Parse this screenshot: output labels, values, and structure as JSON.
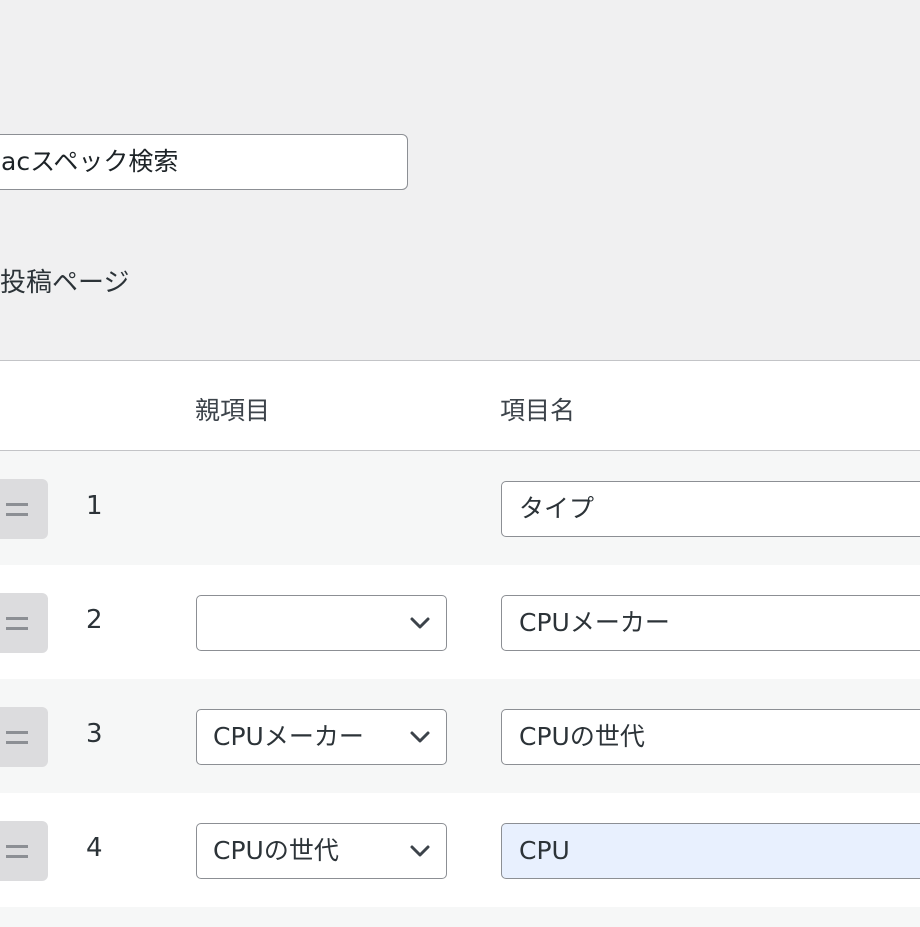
{
  "form": {
    "title_value": "acスペック検索",
    "target_label": "投稿ページ"
  },
  "table": {
    "headers": {
      "parent": "親項目",
      "name": "項目名"
    },
    "rows": [
      {
        "number": "1",
        "parent": "",
        "name": "タイプ",
        "has_parent_select": false,
        "focused": false
      },
      {
        "number": "2",
        "parent": "",
        "name": "CPUメーカー",
        "has_parent_select": true,
        "focused": false
      },
      {
        "number": "3",
        "parent": "CPUメーカー",
        "name": "CPUの世代",
        "has_parent_select": true,
        "focused": false
      },
      {
        "number": "4",
        "parent": "CPUの世代",
        "name": "CPU",
        "has_parent_select": true,
        "focused": true
      }
    ]
  },
  "icons": {
    "drag_handle": "drag-handle-icon",
    "dropdown": "chevron-down-icon"
  },
  "colors": {
    "background": "#f0f0f1",
    "focused_field": "#e8f0fe",
    "alt_row": "#f6f7f7",
    "border": "#8c8f94"
  }
}
